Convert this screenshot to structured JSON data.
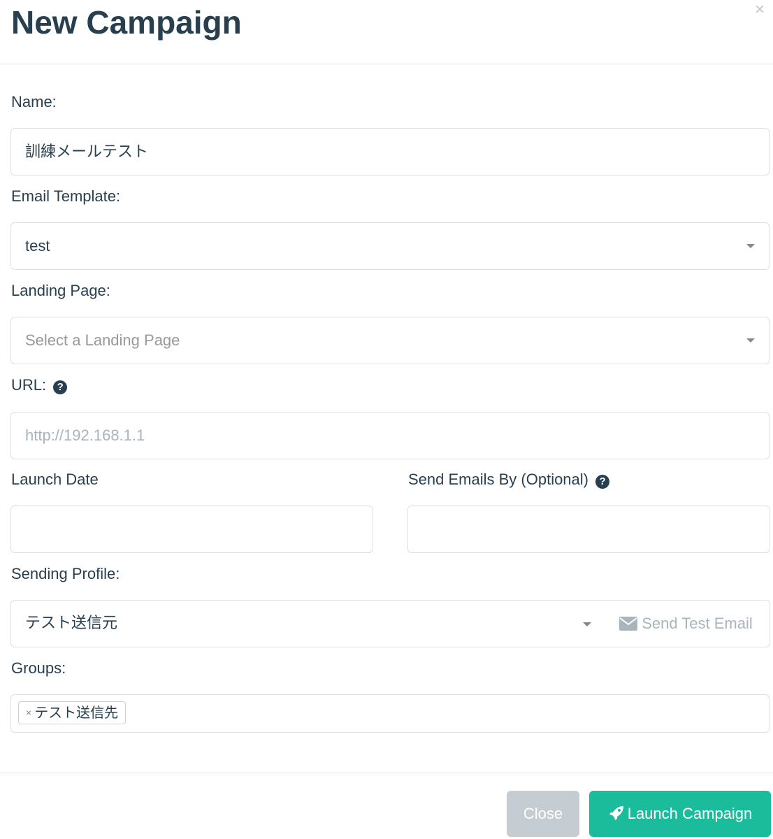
{
  "modal": {
    "title": "New Campaign",
    "close_symbol": "×"
  },
  "form": {
    "name": {
      "label": "Name:",
      "value": "訓練メールテスト"
    },
    "email_template": {
      "label": "Email Template:",
      "value": "test"
    },
    "landing_page": {
      "label": "Landing Page:",
      "placeholder": "Select a Landing Page"
    },
    "url": {
      "label": "URL:",
      "placeholder": "http://192.168.1.1",
      "help_icon": "question-circle-icon"
    },
    "launch_date": {
      "label": "Launch Date",
      "value": ""
    },
    "send_by": {
      "label": "Send Emails By (Optional)",
      "value": "",
      "help_icon": "question-circle-icon"
    },
    "sending_profile": {
      "label": "Sending Profile:",
      "value": "テスト送信元",
      "test_button": "Send Test Email",
      "test_icon": "envelope-icon"
    },
    "groups": {
      "label": "Groups:",
      "tags": [
        {
          "remove": "×",
          "label": "テスト送信先"
        }
      ]
    }
  },
  "footer": {
    "close_label": "Close",
    "launch_label": "Launch Campaign",
    "launch_icon": "rocket-icon"
  },
  "colors": {
    "heading": "#283f50",
    "accent": "#1abc9c",
    "disabled": "#c5ccd2"
  }
}
